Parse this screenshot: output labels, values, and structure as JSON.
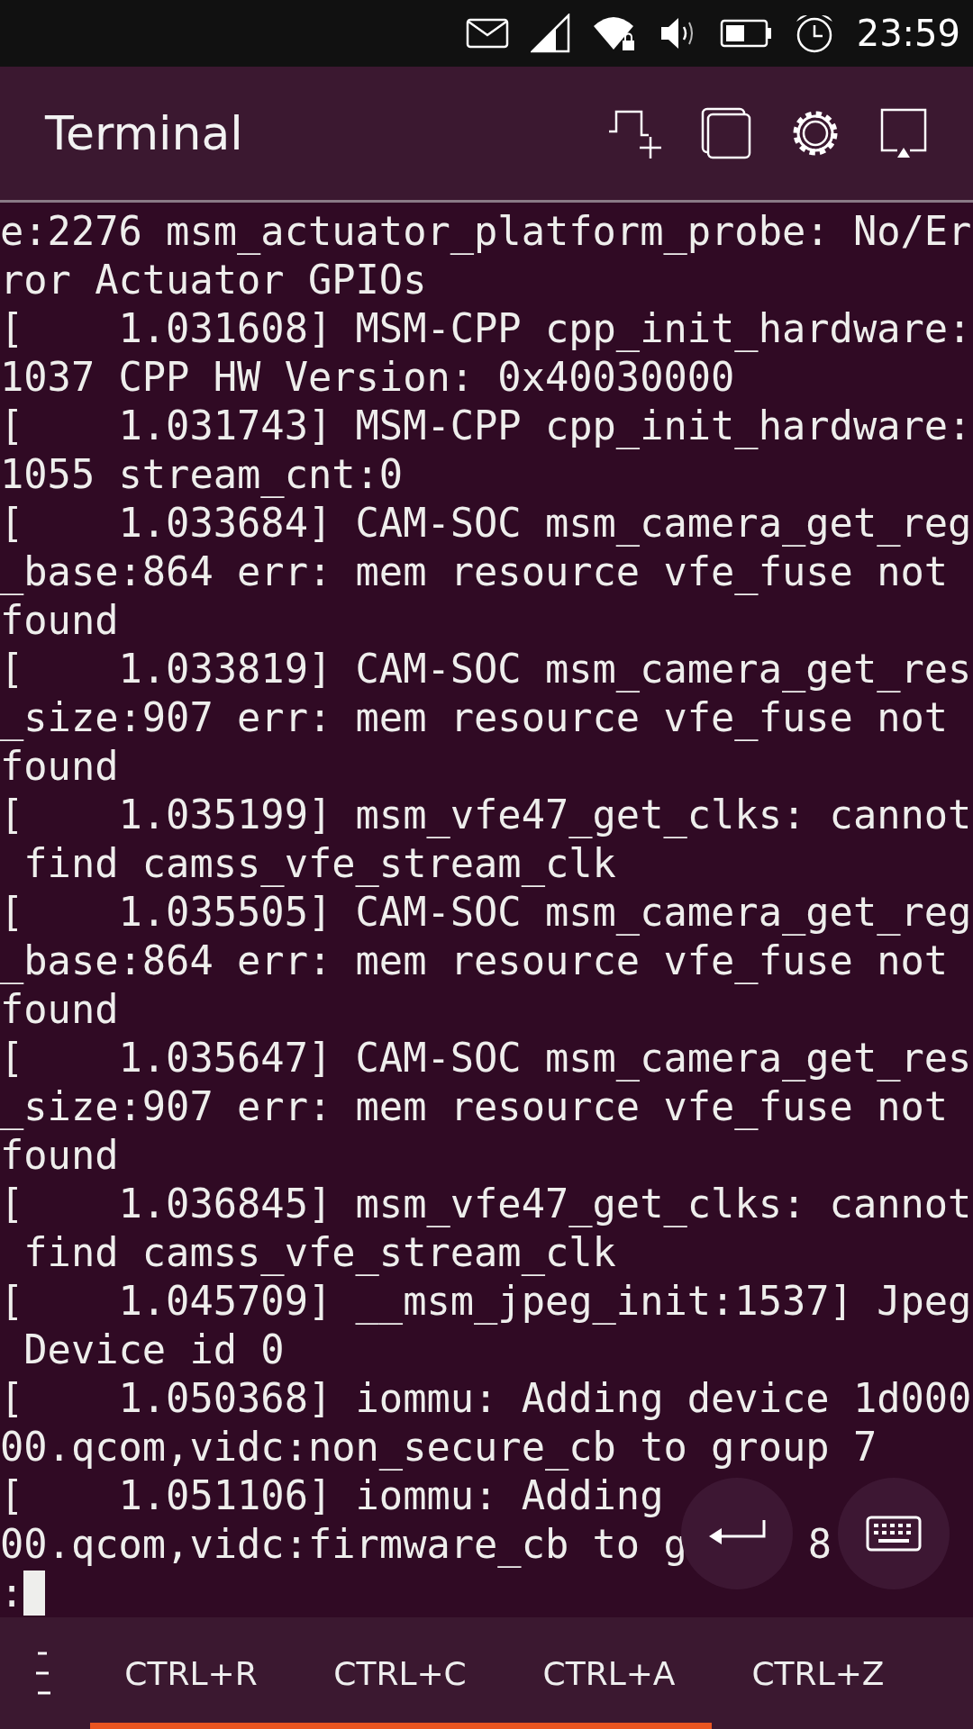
{
  "status_bar": {
    "time": "23:59"
  },
  "header": {
    "title": "Terminal"
  },
  "terminal": {
    "lines": [
      "e:2276 msm_actuator_platform_probe: No/Er",
      "ror Actuator GPIOs",
      "[    1.031608] MSM-CPP cpp_init_hardware:",
      "1037 CPP HW Version: 0x40030000",
      "[    1.031743] MSM-CPP cpp_init_hardware:",
      "1055 stream_cnt:0",
      "[    1.033684] CAM-SOC msm_camera_get_reg",
      "_base:864 err: mem resource vfe_fuse not",
      "found",
      "[    1.033819] CAM-SOC msm_camera_get_res",
      "_size:907 err: mem resource vfe_fuse not",
      "found",
      "[    1.035199] msm_vfe47_get_clks: cannot",
      " find camss_vfe_stream_clk",
      "[    1.035505] CAM-SOC msm_camera_get_reg",
      "_base:864 err: mem resource vfe_fuse not",
      "found",
      "[    1.035647] CAM-SOC msm_camera_get_res",
      "_size:907 err: mem resource vfe_fuse not",
      "found",
      "[    1.036845] msm_vfe47_get_clks: cannot",
      " find camss_vfe_stream_clk",
      "[    1.045709] __msm_jpeg_init:1537] Jpeg",
      " Device id 0",
      "[    1.050368] iommu: Adding device 1d000",
      "00.qcom,vidc:non_secure_cb to group 7",
      "[    1.051106] iommu: Adding",
      "00.qcom,vidc:firmware_cb to g"
    ],
    "prompt": ":"
  },
  "shortcut_keys": [
    "CTRL+R",
    "CTRL+C",
    "CTRL+A",
    "CTRL+Z"
  ],
  "trailing_text": [
    "8"
  ]
}
